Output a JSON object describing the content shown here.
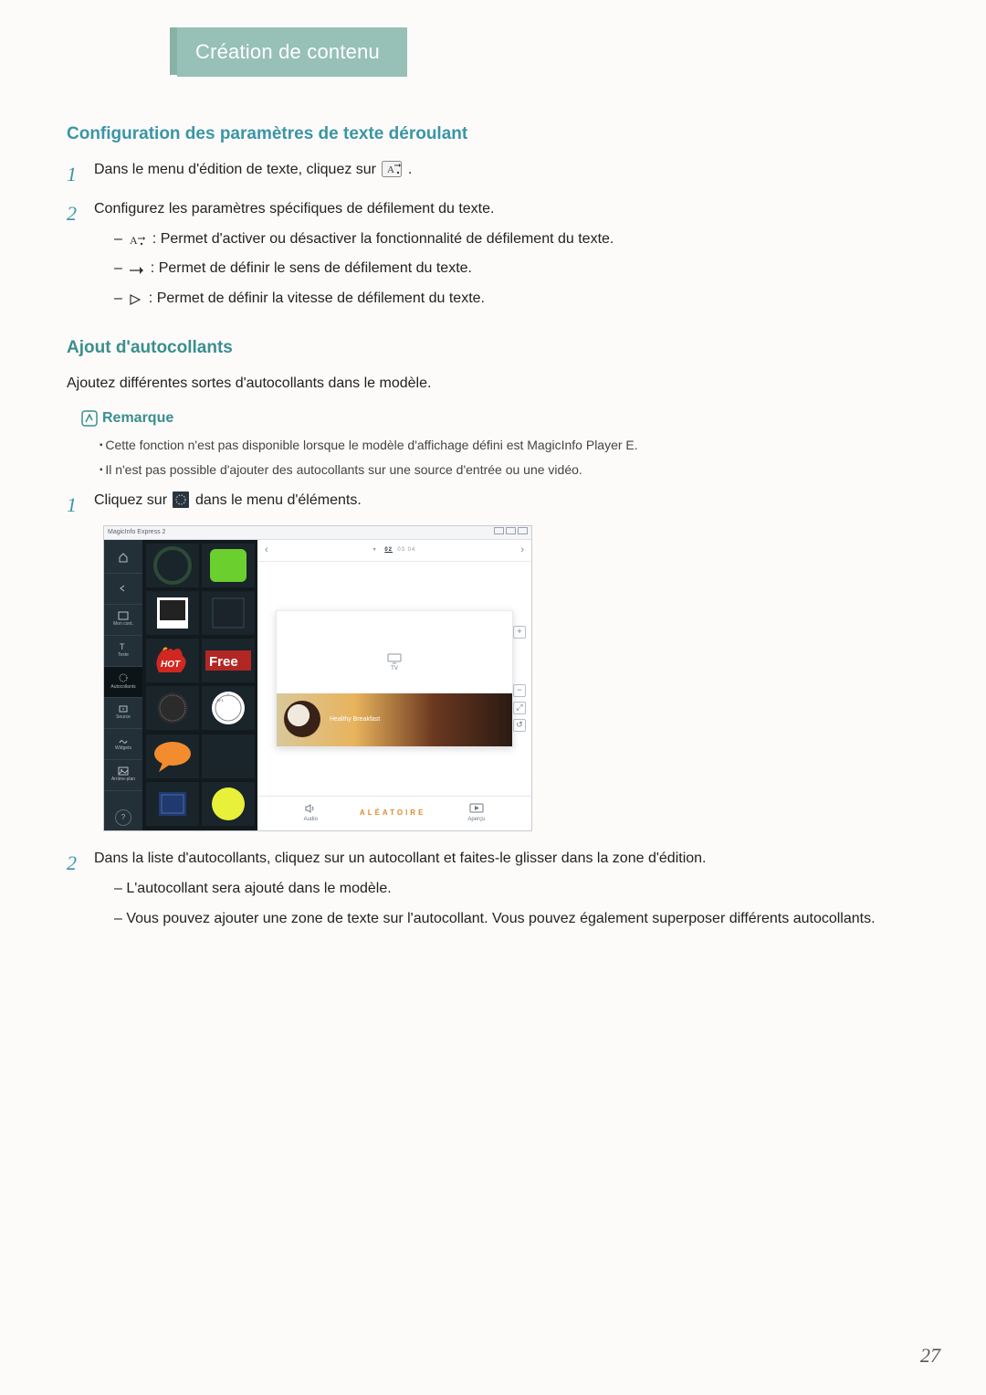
{
  "chapter_tab": "Création de contenu",
  "page_number": "27",
  "section1": {
    "title": "Configuration des paramètres de texte déroulant",
    "step1": {
      "pre": "Dans le menu d'édition de texte, cliquez sur ",
      "post": "."
    },
    "step2": {
      "lead": "Configurez les paramètres spécifiques de défilement du texte.",
      "bullets": [
        " : Permet d'activer ou désactiver la fonctionnalité de défilement du texte.",
        " : Permet de définir le sens de défilement du texte.",
        " : Permet de définir la vitesse de défilement du texte."
      ]
    }
  },
  "section2": {
    "title": "Ajout d'autocollants",
    "intro": "Ajoutez différentes sortes d'autocollants dans le modèle.",
    "remark_label": "Remarque",
    "remark_items": [
      "Cette fonction n'est pas disponible lorsque le modèle d'affichage défini est MagicInfo Player E.",
      "Il n'est pas possible d'ajouter des autocollants sur une source d'entrée ou une vidéo."
    ],
    "step1": {
      "pre": "Cliquez sur ",
      "post": " dans le menu d'éléments."
    },
    "step2": {
      "lead": "Dans la liste d'autocollants, cliquez sur un autocollant et faites-le glisser dans la zone d'édition.",
      "bullets": [
        "L'autocollant sera ajouté dans le modèle.",
        "Vous pouvez ajouter une zone de texte sur l'autocollant. Vous pouvez également superposer différents autocollants."
      ]
    }
  },
  "app": {
    "title": "MagicInfo Express 2",
    "sidebar": [
      "",
      "",
      "Mon cont.",
      "Texte",
      "Autocollants",
      "Source",
      "Widgets",
      "Arrière-plan"
    ],
    "timecodes": {
      "sel": "02",
      "rest": "03   04"
    },
    "tv_label": "TV",
    "food_caption": "Healthy Breakfast",
    "bottom_center": "ALÉATOIRE",
    "bottom_left": "Audio",
    "bottom_right": "Aperçu",
    "colors": {
      "hot": "#d02821",
      "free_bg": "#b22623",
      "green": "#6bcf2e",
      "orange": "#f28c2e",
      "yellow": "#e8f03a",
      "navy": "#1f3a6f"
    }
  }
}
